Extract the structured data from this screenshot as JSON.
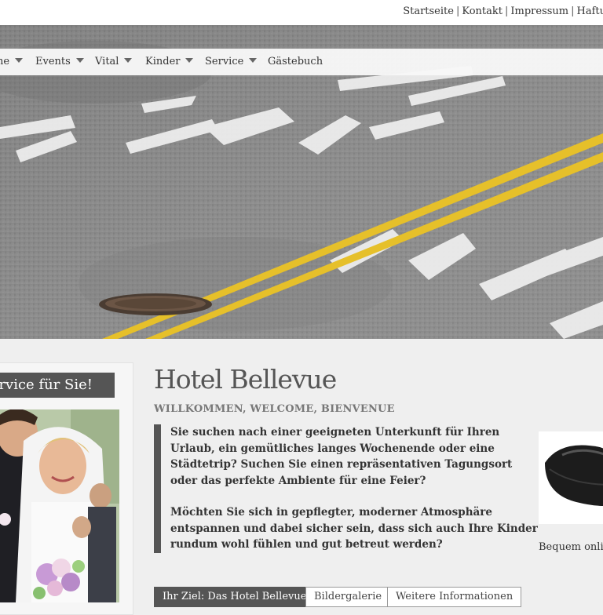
{
  "top_links": [
    {
      "label": "Startseite"
    },
    {
      "label": "Kontakt"
    },
    {
      "label": "Impressum"
    },
    {
      "label": "Haftu"
    }
  ],
  "top_separator": "|",
  "nav": {
    "items": [
      {
        "label": "ne",
        "has_dropdown": true
      },
      {
        "label": "Events",
        "has_dropdown": true
      },
      {
        "label": "Vital",
        "has_dropdown": true
      },
      {
        "label": "Kinder",
        "has_dropdown": true
      },
      {
        "label": "Service",
        "has_dropdown": true
      },
      {
        "label": "Gästebuch",
        "has_dropdown": false
      }
    ]
  },
  "sidebar": {
    "heading": "ervice für Sie!"
  },
  "main": {
    "title": "Hotel Bellevue",
    "subheading": "WILLKOMMEN, WELCOME, BIENVENUE",
    "paragraphs": [
      "Sie suchen nach einer geeigneten Unterkunft für Ihren Urlaub, ein gemütliches langes Wochenende oder eine Städtetrip? Suchen Sie einen repräsentativen Tagungsort oder das perfekte Ambiente für eine Feier?",
      "Möchten Sie sich in gepflegter, moderner Atmosphäre entspannen und dabei sicher sein, dass sich auch Ihre Kinder rundum wohl fühlen und gut betreut werden?"
    ],
    "tabs": [
      {
        "label": "Ihr Ziel: Das Hotel Bellevue",
        "active": true
      },
      {
        "label": "Bildergalerie",
        "active": false
      },
      {
        "label": "Weitere Informationen",
        "active": false
      }
    ]
  },
  "teaser": {
    "caption": "Bequem onlin"
  },
  "colors": {
    "accent_dark": "#555555",
    "road_yellow": "#e6c02a",
    "road_gray": "#8f8f8f"
  },
  "icons": {
    "dropdown": "caret-down-icon"
  }
}
